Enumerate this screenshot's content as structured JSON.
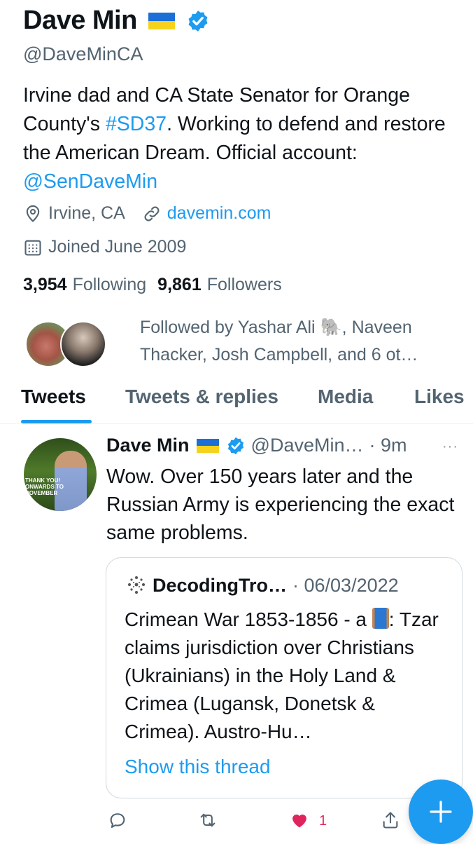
{
  "profile": {
    "name": "Dave Min",
    "flag_colors": [
      "#1d6fd6",
      "#f7d21c"
    ],
    "handle": "@DaveMinCA",
    "bio": {
      "p1": "Irvine dad and CA State Senator for Orange County's ",
      "hashtag": "#SD37",
      "p2": ". Working to defend and restore the American Dream. Official account: ",
      "mention": "@SenDaveMin"
    },
    "location": "Irvine, CA",
    "website": "davemin.com",
    "joined": "Joined June 2009",
    "following_count": "3,954",
    "following_label": "Following",
    "followers_count": "9,861",
    "followers_label": "Followers",
    "followed_by": "Followed by Yashar Ali 🐘, Naveen Thacker, Josh Campbell, and 6 ot…"
  },
  "tabs": [
    {
      "label": "Tweets",
      "active": true
    },
    {
      "label": "Tweets & replies",
      "active": false
    },
    {
      "label": "Media",
      "active": false
    },
    {
      "label": "Likes",
      "active": false
    }
  ],
  "tweet": {
    "name": "Dave Min",
    "handle": "@DaveMin…",
    "time": "· 9m",
    "more": "···",
    "text": "Wow. Over 150 years later and the Russian Army is experiencing the exact same problems.",
    "avatar_sign": "THANK YOU! ONWARDS TO NOVEMBER",
    "quote": {
      "name": "DecodingTro…",
      "date": "· 06/03/2022",
      "text_a": "Crimean War 1853-1856 - a ",
      "text_b": ": Tzar claims jurisdiction over Christians (Ukrainians) in the Holy Land & Crimea (Lugansk, Donetsk & Crimea). Austro-Hu…",
      "show_thread": "Show this thread"
    },
    "actions": {
      "like_count": "1"
    }
  },
  "colors": {
    "accent": "#1d9bf0",
    "like": "#e0245e"
  },
  "icons": [
    "verified-badge-icon",
    "location-pin-icon",
    "link-icon",
    "calendar-icon",
    "reply-icon",
    "retweet-icon",
    "heart-icon",
    "share-icon",
    "compose-plus-icon",
    "more-dots-icon"
  ]
}
